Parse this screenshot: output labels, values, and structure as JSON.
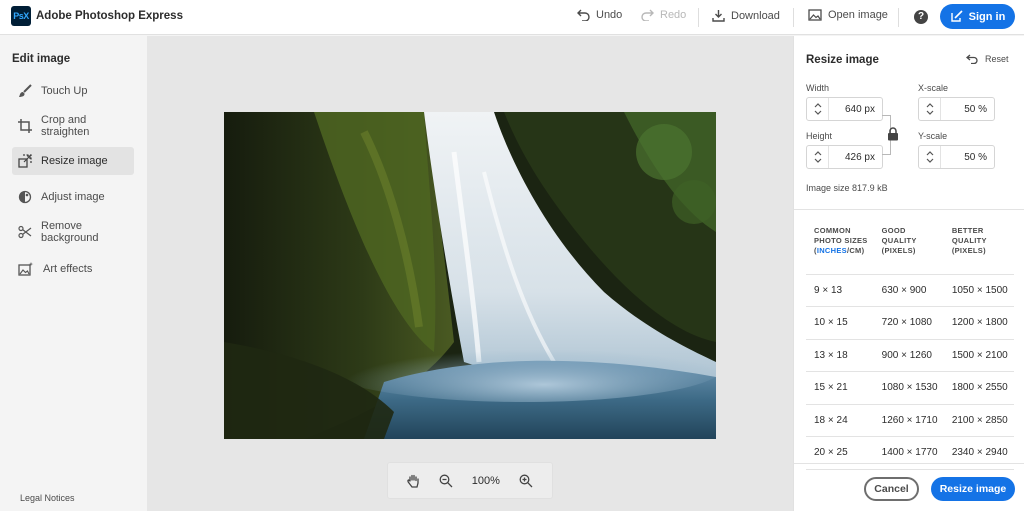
{
  "header": {
    "logo_text": "PsX",
    "app_title": "Adobe Photoshop Express",
    "undo_label": "Undo",
    "redo_label": "Redo",
    "download_label": "Download",
    "open_image_label": "Open image",
    "help_glyph": "?",
    "signin_label": "Sign in"
  },
  "sidebar": {
    "heading": "Edit image",
    "items": [
      {
        "label": "Touch Up",
        "icon": "brush-icon"
      },
      {
        "label": "Crop and straighten",
        "icon": "crop-icon"
      },
      {
        "label": "Resize image",
        "icon": "resize-icon",
        "active": true
      },
      {
        "label": "Adjust image",
        "icon": "adjust-icon"
      },
      {
        "label": "Remove background",
        "icon": "scissors-icon"
      },
      {
        "label": "Art effects",
        "icon": "art-effects-icon"
      }
    ],
    "legal_label": "Legal Notices"
  },
  "canvas": {
    "zoom_value": "100%"
  },
  "resize_panel": {
    "heading": "Resize image",
    "reset_label": "Reset",
    "width_label": "Width",
    "width_value": "640 px",
    "height_label": "Height",
    "height_value": "426 px",
    "xscale_label": "X-scale",
    "xscale_value": "50 %",
    "yscale_label": "Y-scale",
    "yscale_value": "50 %",
    "image_size_label": "Image size",
    "image_size_value": "817.9 kB",
    "table": {
      "col1_line1": "COMMON",
      "col1_line2": "PHOTO SIZES",
      "col1_unit_inches": "INCHES",
      "col1_unit_sep": "/",
      "col1_unit_cm": "CM",
      "col2_line1": "GOOD",
      "col2_line2": "QUALITY",
      "col2_line3": "(PIXELS)",
      "col3_line1": "BETTER",
      "col3_line2": "QUALITY",
      "col3_line3": "(PIXELS)",
      "rows": [
        {
          "size": "9 × 13",
          "good": "630 × 900",
          "better": "1050 × 1500"
        },
        {
          "size": "10 × 15",
          "good": "720 × 1080",
          "better": "1200 × 1800"
        },
        {
          "size": "13 × 18",
          "good": "900 × 1260",
          "better": "1500 × 2100"
        },
        {
          "size": "15 × 21",
          "good": "1080 × 1530",
          "better": "1800 × 2550"
        },
        {
          "size": "18 × 24",
          "good": "1260 × 1710",
          "better": "2100 × 2850"
        },
        {
          "size": "20 × 25",
          "good": "1400 × 1770",
          "better": "2340 × 2940"
        }
      ]
    },
    "cancel_label": "Cancel",
    "resize_label": "Resize image"
  },
  "colors": {
    "accent": "#1473e6",
    "logo_bg": "#001e36",
    "logo_text": "#31a8ff"
  }
}
